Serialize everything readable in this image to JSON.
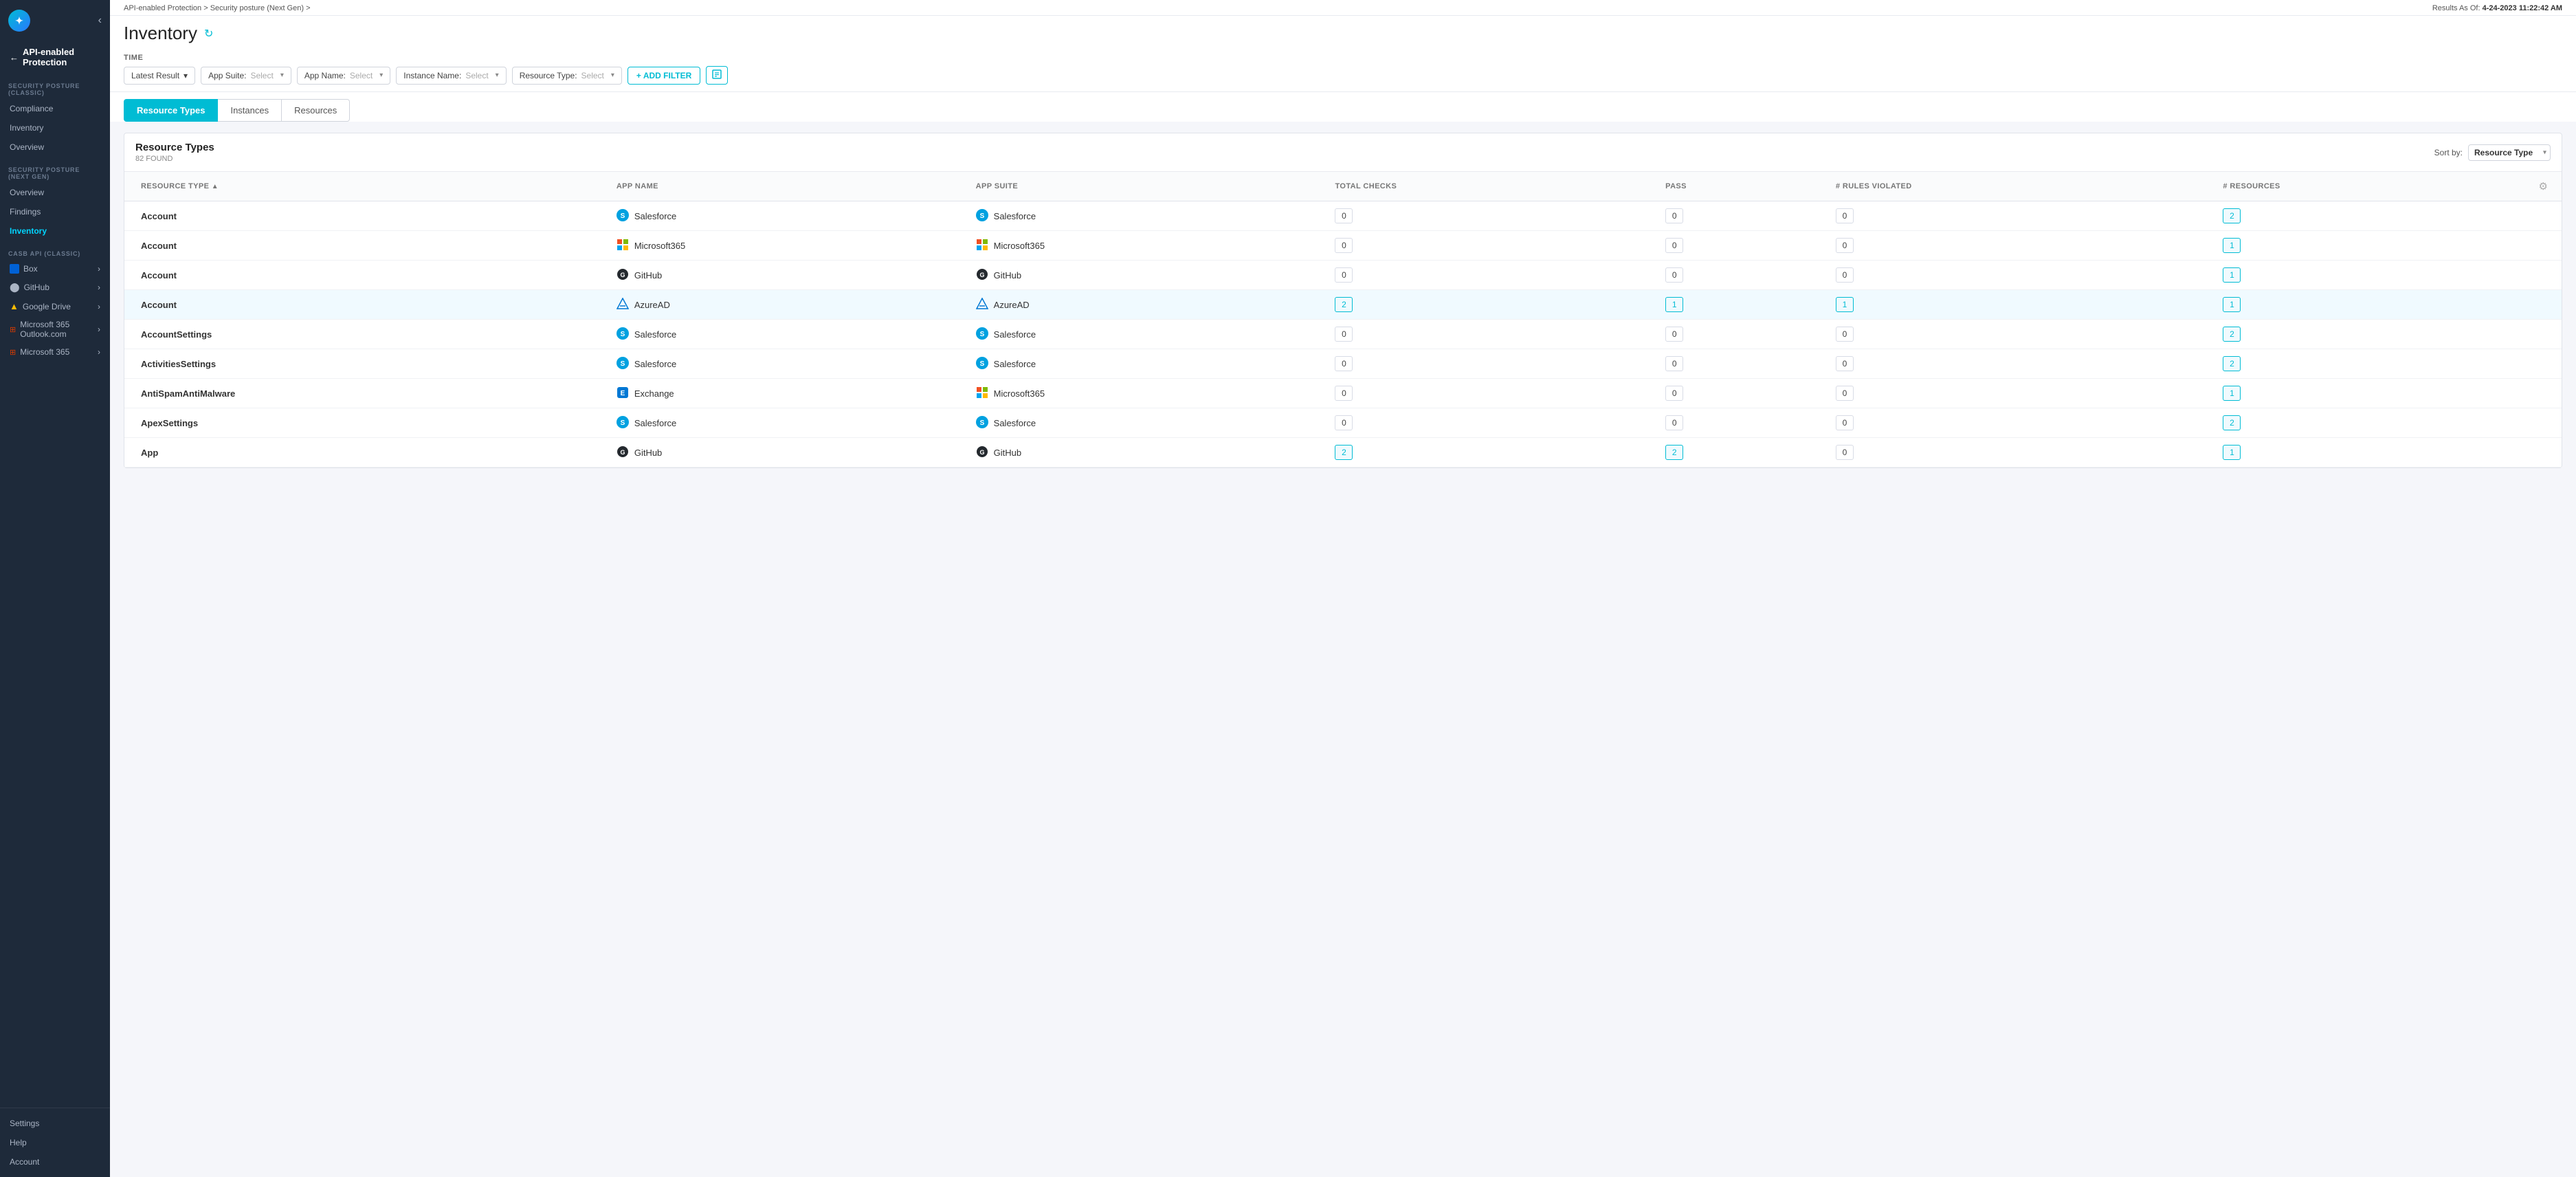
{
  "meta": {
    "results_as_of": "Results As Of:",
    "timestamp": "4-24-2023 11:22:42 AM"
  },
  "breadcrumb": {
    "parts": [
      "API-enabled Protection",
      "Security posture (Next Gen)",
      ""
    ]
  },
  "page": {
    "title": "Inventory",
    "refresh_label": "↻"
  },
  "filters": {
    "time_label": "TIME",
    "time_value": "Latest Result",
    "app_suite_label": "App Suite:",
    "app_suite_placeholder": "Select",
    "app_name_label": "App Name:",
    "app_name_placeholder": "Select",
    "instance_name_label": "Instance Name:",
    "instance_name_placeholder": "Select",
    "resource_type_label": "Resource Type:",
    "resource_type_placeholder": "Select",
    "add_filter_label": "+ ADD FILTER"
  },
  "tabs": [
    {
      "id": "resource-types",
      "label": "Resource Types",
      "active": true
    },
    {
      "id": "instances",
      "label": "Instances",
      "active": false
    },
    {
      "id": "resources",
      "label": "Resources",
      "active": false
    }
  ],
  "table": {
    "title": "Resource Types",
    "count": "82 FOUND",
    "sort_label": "Sort by:",
    "sort_value": "Resource Type",
    "columns": [
      {
        "id": "resource-type",
        "label": "Resource Type"
      },
      {
        "id": "app-name",
        "label": "App Name"
      },
      {
        "id": "app-suite",
        "label": "App Suite"
      },
      {
        "id": "total-checks",
        "label": "Total Checks"
      },
      {
        "id": "pass",
        "label": "Pass"
      },
      {
        "id": "rules-violated",
        "label": "# Rules Violated"
      },
      {
        "id": "resources",
        "label": "# Resources"
      }
    ],
    "rows": [
      {
        "resource_type": "Account",
        "app_name": "Salesforce",
        "app_name_icon": "sf",
        "app_suite": "Salesforce",
        "app_suite_icon": "sf",
        "total_checks": "0",
        "pass": "0",
        "rules_violated": "0",
        "resources": "2",
        "highlight": false
      },
      {
        "resource_type": "Account",
        "app_name": "Microsoft365",
        "app_name_icon": "ms",
        "app_suite": "Microsoft365",
        "app_suite_icon": "ms",
        "total_checks": "0",
        "pass": "0",
        "rules_violated": "0",
        "resources": "1",
        "highlight": false
      },
      {
        "resource_type": "Account",
        "app_name": "GitHub",
        "app_name_icon": "gh",
        "app_suite": "GitHub",
        "app_suite_icon": "gh",
        "total_checks": "0",
        "pass": "0",
        "rules_violated": "0",
        "resources": "1",
        "highlight": false
      },
      {
        "resource_type": "Account",
        "app_name": "AzureAD",
        "app_name_icon": "az",
        "app_suite": "AzureAD",
        "app_suite_icon": "az",
        "total_checks": "2",
        "pass": "1",
        "rules_violated": "1",
        "resources": "1",
        "highlight": true
      },
      {
        "resource_type": "AccountSettings",
        "app_name": "Salesforce",
        "app_name_icon": "sf",
        "app_suite": "Salesforce",
        "app_suite_icon": "sf",
        "total_checks": "0",
        "pass": "0",
        "rules_violated": "0",
        "resources": "2",
        "highlight": false
      },
      {
        "resource_type": "ActivitiesSettings",
        "app_name": "Salesforce",
        "app_name_icon": "sf",
        "app_suite": "Salesforce",
        "app_suite_icon": "sf",
        "total_checks": "0",
        "pass": "0",
        "rules_violated": "0",
        "resources": "2",
        "highlight": false
      },
      {
        "resource_type": "AntiSpamAntiMalware",
        "app_name": "Exchange",
        "app_name_icon": "ex",
        "app_suite": "Microsoft365",
        "app_suite_icon": "ms",
        "total_checks": "0",
        "pass": "0",
        "rules_violated": "0",
        "resources": "1",
        "highlight": false
      },
      {
        "resource_type": "ApexSettings",
        "app_name": "Salesforce",
        "app_name_icon": "sf",
        "app_suite": "Salesforce",
        "app_suite_icon": "sf",
        "total_checks": "0",
        "pass": "0",
        "rules_violated": "0",
        "resources": "2",
        "highlight": false
      },
      {
        "resource_type": "App",
        "app_name": "GitHub",
        "app_name_icon": "gh",
        "app_suite": "GitHub",
        "app_suite_icon": "gh",
        "total_checks": "2",
        "pass": "2",
        "rules_violated": "0",
        "resources": "1",
        "highlight": false
      }
    ]
  },
  "sidebar": {
    "nav_title": "API-enabled Protection",
    "sections": [
      {
        "label": "Security Posture (Classic)",
        "items": [
          {
            "id": "compliance",
            "label": "Compliance"
          },
          {
            "id": "inventory-classic",
            "label": "Inventory"
          },
          {
            "id": "overview-classic",
            "label": "Overview"
          }
        ]
      },
      {
        "label": "Security Posture (Next Gen)",
        "items": [
          {
            "id": "overview-ng",
            "label": "Overview"
          },
          {
            "id": "findings",
            "label": "Findings"
          },
          {
            "id": "inventory-ng",
            "label": "Inventory",
            "active": true
          }
        ]
      },
      {
        "label": "CASB API (Classic)",
        "apps": [
          {
            "id": "box",
            "label": "Box",
            "icon": "box"
          },
          {
            "id": "github",
            "label": "GitHub",
            "icon": "gh"
          },
          {
            "id": "google-drive",
            "label": "Google Drive",
            "icon": "gd"
          },
          {
            "id": "ms365-outlook",
            "label": "Microsoft 365 Outlook.com",
            "icon": "ms"
          },
          {
            "id": "ms365",
            "label": "Microsoft 365",
            "icon": "ms"
          }
        ]
      }
    ],
    "bottom_items": [
      {
        "id": "settings",
        "label": "Settings"
      },
      {
        "id": "help",
        "label": "Help"
      },
      {
        "id": "account",
        "label": "Account"
      }
    ]
  }
}
